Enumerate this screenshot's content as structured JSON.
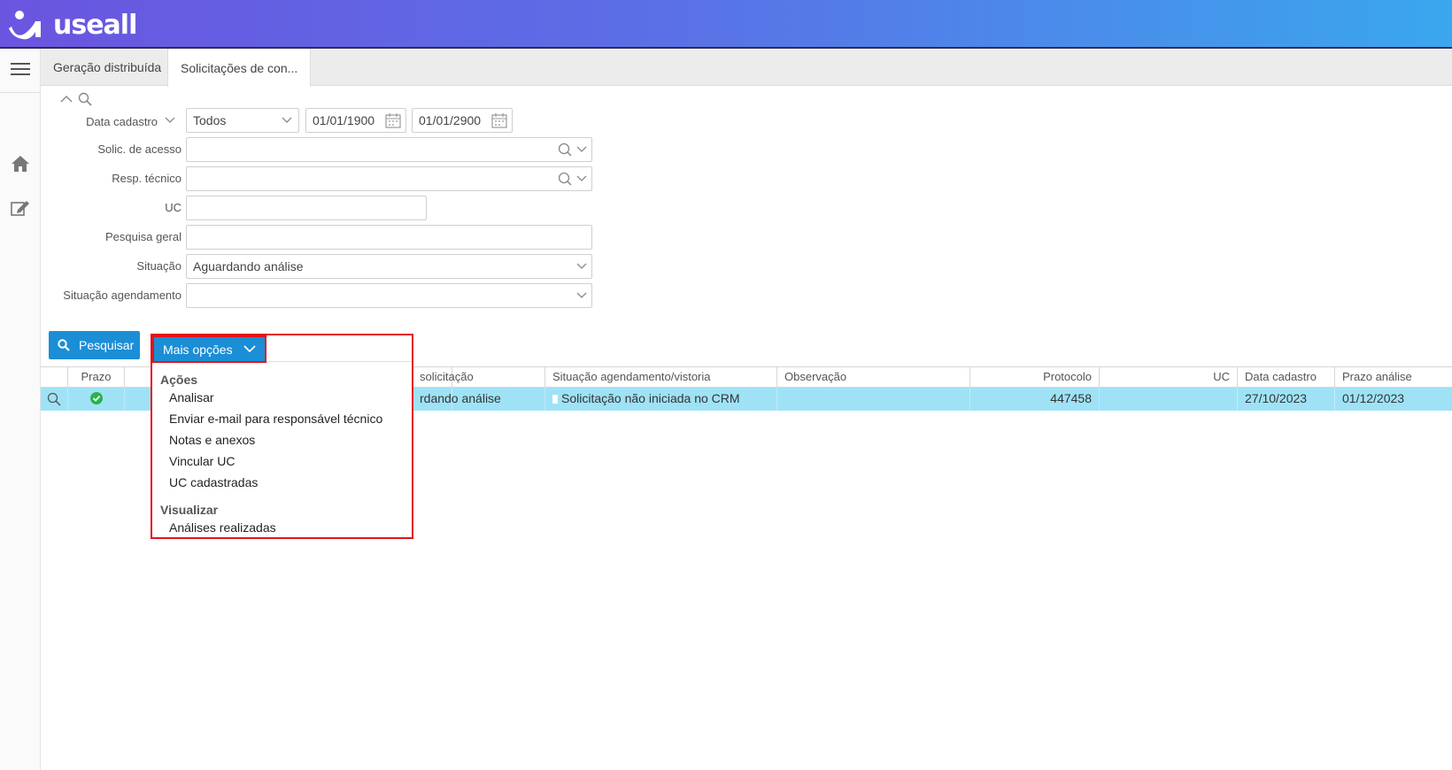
{
  "app": {
    "logo_text": "useall"
  },
  "tabs": [
    {
      "label": "Geração distribuída"
    },
    {
      "label": "Solicitações de con..."
    }
  ],
  "filters": {
    "data_cadastro": {
      "label": "Data cadastro",
      "period": "Todos",
      "from": "01/01/1900",
      "to": "01/01/2900"
    },
    "solic_acesso": {
      "label": "Solic. de acesso",
      "value": ""
    },
    "resp_tecnico": {
      "label": "Resp. técnico",
      "value": ""
    },
    "uc": {
      "label": "UC",
      "value": ""
    },
    "pesquisa_geral": {
      "label": "Pesquisa geral",
      "value": ""
    },
    "situacao": {
      "label": "Situação",
      "value": "Aguardando análise"
    },
    "situacao_agendamento": {
      "label": "Situação agendamento",
      "value": ""
    }
  },
  "buttons": {
    "search": "Pesquisar",
    "more": "Mais opções"
  },
  "menu": {
    "groups": [
      {
        "title": "Ações",
        "items": [
          "Analisar",
          "Enviar e-mail para responsável técnico",
          "Notas e anexos",
          "Vincular UC",
          "UC cadastradas"
        ]
      },
      {
        "title": "Visualizar",
        "items": [
          "Análises realizadas"
        ]
      }
    ]
  },
  "table": {
    "columns": [
      "Prazo",
      "",
      "solicitação",
      "Situação agendamento/vistoria",
      "Observação",
      "Protocolo",
      "UC",
      "Data cadastro",
      "Prazo análise"
    ],
    "rows": [
      {
        "situacao": "rdando análise",
        "agendamento": "Solicitação não iniciada no CRM",
        "observacao": "",
        "protocolo": "447458",
        "uc": "",
        "data_cadastro": "27/10/2023",
        "prazo_analise": "01/12/2023"
      }
    ]
  },
  "colors": {
    "accent": "#1b8ed6",
    "highlight_row": "#9fe2f6",
    "annotation": "#e3121b",
    "ok_status": "#2bb24c"
  }
}
